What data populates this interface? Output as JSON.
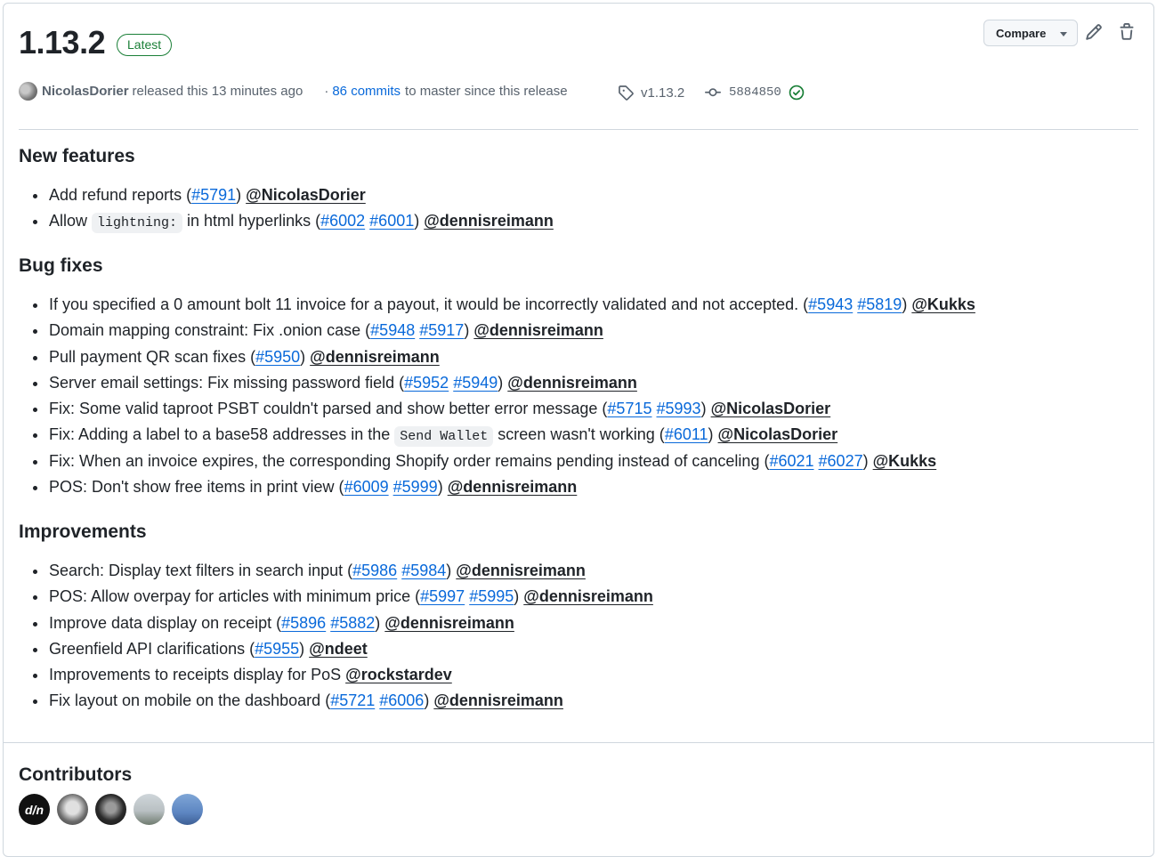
{
  "release": {
    "version": "1.13.2",
    "badge": "Latest",
    "author": "NicolasDorier",
    "released_text": "released this 13 minutes ago",
    "commits_prefix": "·",
    "commits_link": "86 commits",
    "commits_suffix": "to master since this release",
    "tag": "v1.13.2",
    "commit_sha": "5884850"
  },
  "toolbar": {
    "compare_label": "Compare",
    "edit_icon": "pencil-icon",
    "delete_icon": "trash-icon"
  },
  "sections": {
    "new_features": {
      "title": "New features",
      "items": [
        {
          "text_before": "Add refund reports (",
          "prs": [
            "#5791"
          ],
          "text_after": ")",
          "user": "@NicolasDorier"
        },
        {
          "text_before": "Allow ",
          "code": "lightning:",
          "text_mid": " in html hyperlinks (",
          "prs": [
            "#6002",
            "#6001"
          ],
          "text_after": ")",
          "user": "@dennisreimann"
        }
      ]
    },
    "bug_fixes": {
      "title": "Bug fixes",
      "items": [
        {
          "text_before": "If you specified a 0 amount bolt 11 invoice for a payout, it would be incorrectly validated and not accepted. (",
          "prs": [
            "#5943",
            "#5819"
          ],
          "text_after": ")",
          "user": "@Kukks"
        },
        {
          "text_before": "Domain mapping constraint: Fix .onion case (",
          "prs": [
            "#5948",
            "#5917"
          ],
          "text_after": ")",
          "user": "@dennisreimann"
        },
        {
          "text_before": "Pull payment QR scan fixes (",
          "prs": [
            "#5950"
          ],
          "text_after": ")",
          "user": "@dennisreimann"
        },
        {
          "text_before": "Server email settings: Fix missing password field (",
          "prs": [
            "#5952",
            "#5949"
          ],
          "text_after": ")",
          "user": "@dennisreimann"
        },
        {
          "text_before": "Fix: Some valid taproot PSBT couldn't parsed and show better error message (",
          "prs": [
            "#5715",
            "#5993"
          ],
          "text_after": ")",
          "user": "@NicolasDorier"
        },
        {
          "text_before": "Fix: Adding a label to a base58 addresses in the ",
          "code": "Send Wallet",
          "text_mid": " screen wasn't working (",
          "prs": [
            "#6011"
          ],
          "text_after": ")",
          "user": "@NicolasDorier"
        },
        {
          "text_before": "Fix: When an invoice expires, the corresponding Shopify order remains pending instead of canceling (",
          "prs": [
            "#6021",
            "#6027"
          ],
          "text_after": ")",
          "user": "@Kukks"
        },
        {
          "text_before": "POS: Don't show free items in print view (",
          "prs": [
            "#6009",
            "#5999"
          ],
          "text_after": ")",
          "user": "@dennisreimann"
        }
      ]
    },
    "improvements": {
      "title": "Improvements",
      "items": [
        {
          "text_before": "Search: Display text filters in search input (",
          "prs": [
            "#5986",
            "#5984"
          ],
          "text_after": ")",
          "user": "@dennisreimann"
        },
        {
          "text_before": "POS: Allow overpay for articles with minimum price (",
          "prs": [
            "#5997",
            "#5995"
          ],
          "text_after": ")",
          "user": "@dennisreimann"
        },
        {
          "text_before": "Improve data display on receipt (",
          "prs": [
            "#5896",
            "#5882"
          ],
          "text_after": ")",
          "user": "@dennisreimann"
        },
        {
          "text_before": "Greenfield API clarifications (",
          "prs": [
            "#5955"
          ],
          "text_after": ")",
          "user": "@ndeet"
        },
        {
          "text_before": "Improvements to receipts display for PoS ",
          "prs": [],
          "text_after": "",
          "user": "@rockstardev"
        },
        {
          "text_before": "Fix layout on mobile on the dashboard (",
          "prs": [
            "#5721",
            "#6006"
          ],
          "text_after": ")",
          "user": "@dennisreimann"
        }
      ]
    }
  },
  "contributors": {
    "title": "Contributors",
    "avatars": [
      "avatar-dennisreimann",
      "avatar-nicolasdorier",
      "avatar-kukks",
      "avatar-ndeet",
      "avatar-rockstardev"
    ]
  },
  "colors": {
    "link": "#0969da",
    "badge_green": "#1a7f37",
    "muted": "#59636e",
    "text": "#1f2328",
    "border": "#d0d7de"
  }
}
